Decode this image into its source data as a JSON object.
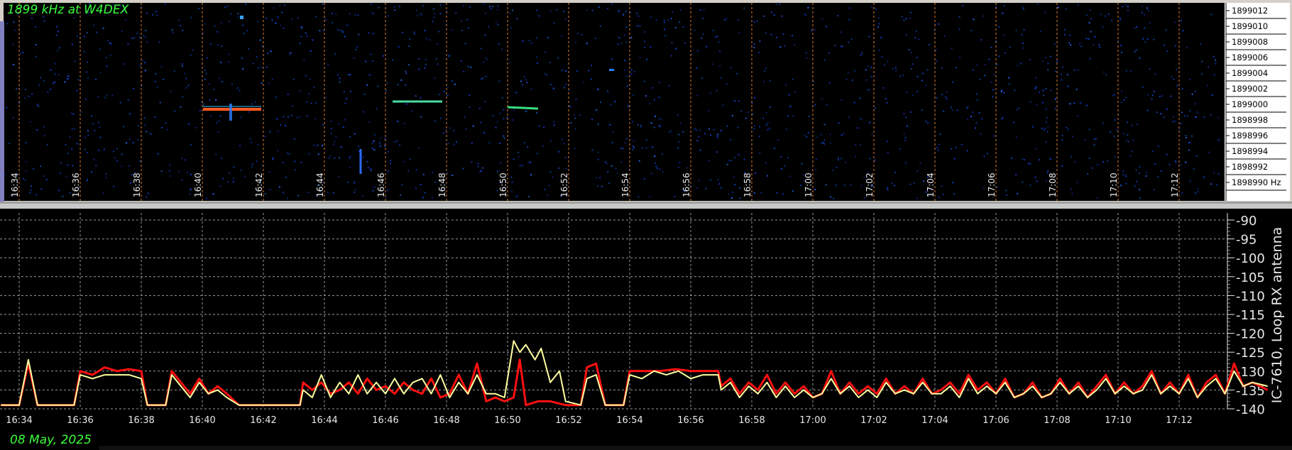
{
  "waterfall": {
    "title": "1899 kHz at W4DEX",
    "freq_labels": [
      "1899012",
      "1899010",
      "1899008",
      "1899006",
      "1899004",
      "1899002",
      "1899000",
      "1898998",
      "1898996",
      "1898994",
      "1898992",
      "1898990 Hz"
    ],
    "time_labels": [
      "16:34",
      "16:36",
      "16:38",
      "16:40",
      "16:42",
      "16:44",
      "16:46",
      "16:48",
      "16:50",
      "16:52",
      "16:54",
      "16:56",
      "16:58",
      "17:00",
      "17:02",
      "17:04",
      "17:06",
      "17:08",
      "17:10",
      "17:12"
    ],
    "colors": {
      "background": "#000000",
      "signal_strong": "#ff5a1e",
      "signal_mid": "#38e080",
      "noise": "#1040c0",
      "grid_line": "#e08030"
    }
  },
  "graph": {
    "date": "08 May, 2025",
    "antenna": "IC-7610, Loop RX antenna",
    "colors": {
      "background": "#000000",
      "grid": "#9a9a9a",
      "series_a": "#ff1010",
      "series_b": "#ffffa0",
      "axis_text": "#e8e8e8"
    }
  },
  "chart_data": {
    "type": "line",
    "ylabel": "IC-7610, Loop RX antenna",
    "ylim": [
      -140,
      -90
    ],
    "yticks": [
      -90,
      -95,
      -100,
      -105,
      -110,
      -115,
      -120,
      -125,
      -130,
      -135,
      -140
    ],
    "x_tick_labels": [
      "16:34",
      "16:36",
      "16:38",
      "16:40",
      "16:42",
      "16:44",
      "16:46",
      "16:48",
      "16:50",
      "16:52",
      "16:54",
      "16:56",
      "16:58",
      "17:00",
      "17:02",
      "17:04",
      "17:06",
      "17:08",
      "17:10",
      "17:12"
    ],
    "x_tick_minutes": [
      0,
      2,
      4,
      6,
      8,
      10,
      12,
      14,
      16,
      18,
      20,
      22,
      24,
      26,
      28,
      30,
      32,
      34,
      36,
      38
    ],
    "xlim_minutes": [
      -0.6,
      40.9
    ],
    "grid": true,
    "series": [
      {
        "color": "#ff1010",
        "points": [
          [
            -0.6,
            -139
          ],
          [
            0,
            -139
          ],
          [
            0.3,
            -128
          ],
          [
            0.6,
            -139
          ],
          [
            1.8,
            -139
          ],
          [
            2.0,
            -130
          ],
          [
            2.4,
            -131
          ],
          [
            2.8,
            -129
          ],
          [
            3.2,
            -130
          ],
          [
            3.6,
            -129.5
          ],
          [
            4.0,
            -130
          ],
          [
            4.2,
            -139
          ],
          [
            4.8,
            -139
          ],
          [
            5.0,
            -130
          ],
          [
            5.3,
            -133
          ],
          [
            5.6,
            -136
          ],
          [
            5.9,
            -132
          ],
          [
            6.2,
            -136
          ],
          [
            6.5,
            -134
          ],
          [
            6.8,
            -136
          ],
          [
            7.2,
            -139
          ],
          [
            8.0,
            -139
          ],
          [
            9.2,
            -139
          ],
          [
            9.3,
            -133
          ],
          [
            9.6,
            -135
          ],
          [
            9.9,
            -133
          ],
          [
            10.2,
            -136
          ],
          [
            10.5,
            -135
          ],
          [
            10.8,
            -133
          ],
          [
            11.1,
            -136
          ],
          [
            11.4,
            -132
          ],
          [
            11.7,
            -135
          ],
          [
            12.0,
            -134
          ],
          [
            12.3,
            -136
          ],
          [
            12.6,
            -133
          ],
          [
            12.9,
            -135
          ],
          [
            13.2,
            -136
          ],
          [
            13.5,
            -132
          ],
          [
            13.8,
            -137
          ],
          [
            14.1,
            -136
          ],
          [
            14.4,
            -131
          ],
          [
            14.7,
            -136
          ],
          [
            15.0,
            -128
          ],
          [
            15.3,
            -138
          ],
          [
            15.6,
            -137
          ],
          [
            15.9,
            -138
          ],
          [
            16.2,
            -137
          ],
          [
            16.4,
            -127
          ],
          [
            16.6,
            -139
          ],
          [
            17.0,
            -138
          ],
          [
            17.4,
            -138
          ],
          [
            17.9,
            -139
          ],
          [
            18.4,
            -139
          ],
          [
            18.6,
            -129
          ],
          [
            18.9,
            -128
          ],
          [
            19.2,
            -139
          ],
          [
            19.8,
            -139
          ],
          [
            20.0,
            -130
          ],
          [
            20.5,
            -130
          ],
          [
            21.0,
            -130
          ],
          [
            21.5,
            -129.5
          ],
          [
            22.0,
            -130
          ],
          [
            22.5,
            -130
          ],
          [
            22.9,
            -130
          ],
          [
            23.0,
            -134
          ],
          [
            23.3,
            -132
          ],
          [
            23.6,
            -136
          ],
          [
            23.9,
            -133
          ],
          [
            24.2,
            -135
          ],
          [
            24.5,
            -131
          ],
          [
            24.8,
            -136
          ],
          [
            25.1,
            -133
          ],
          [
            25.4,
            -136
          ],
          [
            25.7,
            -134
          ],
          [
            26.0,
            -137
          ],
          [
            26.3,
            -136
          ],
          [
            26.6,
            -130
          ],
          [
            26.9,
            -136
          ],
          [
            27.2,
            -133
          ],
          [
            27.5,
            -136
          ],
          [
            27.8,
            -134
          ],
          [
            28.1,
            -136
          ],
          [
            28.4,
            -132
          ],
          [
            28.7,
            -136
          ],
          [
            29.0,
            -134
          ],
          [
            29.3,
            -136
          ],
          [
            29.6,
            -132
          ],
          [
            29.9,
            -136
          ],
          [
            30.2,
            -135
          ],
          [
            30.5,
            -133
          ],
          [
            30.8,
            -136
          ],
          [
            31.1,
            -131
          ],
          [
            31.4,
            -135
          ],
          [
            31.7,
            -133
          ],
          [
            32.0,
            -136
          ],
          [
            32.3,
            -132
          ],
          [
            32.6,
            -137
          ],
          [
            32.9,
            -136
          ],
          [
            33.2,
            -133
          ],
          [
            33.5,
            -137
          ],
          [
            33.8,
            -136
          ],
          [
            34.1,
            -132
          ],
          [
            34.4,
            -136
          ],
          [
            34.7,
            -133
          ],
          [
            35.0,
            -137
          ],
          [
            35.3,
            -134
          ],
          [
            35.6,
            -131
          ],
          [
            35.9,
            -136
          ],
          [
            36.2,
            -133
          ],
          [
            36.5,
            -136
          ],
          [
            36.8,
            -134
          ],
          [
            37.1,
            -130
          ],
          [
            37.4,
            -136
          ],
          [
            37.7,
            -133
          ],
          [
            38.0,
            -136
          ],
          [
            38.3,
            -131
          ],
          [
            38.6,
            -137
          ],
          [
            38.9,
            -133
          ],
          [
            39.2,
            -131
          ],
          [
            39.5,
            -136
          ],
          [
            39.8,
            -128
          ],
          [
            40.1,
            -134
          ],
          [
            40.4,
            -133
          ],
          [
            40.9,
            -135
          ]
        ]
      },
      {
        "color": "#ffffa0",
        "points": [
          [
            -0.6,
            -139
          ],
          [
            0,
            -139
          ],
          [
            0.3,
            -127
          ],
          [
            0.6,
            -139
          ],
          [
            1.8,
            -139
          ],
          [
            2.0,
            -131
          ],
          [
            2.4,
            -132
          ],
          [
            2.8,
            -131
          ],
          [
            3.2,
            -131
          ],
          [
            3.6,
            -131
          ],
          [
            4.0,
            -132
          ],
          [
            4.2,
            -139
          ],
          [
            4.8,
            -139
          ],
          [
            5.0,
            -131
          ],
          [
            5.3,
            -134
          ],
          [
            5.6,
            -137
          ],
          [
            5.9,
            -133
          ],
          [
            6.2,
            -136
          ],
          [
            6.5,
            -135
          ],
          [
            6.8,
            -137
          ],
          [
            7.2,
            -139
          ],
          [
            8.0,
            -139
          ],
          [
            9.2,
            -139
          ],
          [
            9.3,
            -135
          ],
          [
            9.6,
            -137
          ],
          [
            9.9,
            -131
          ],
          [
            10.2,
            -137
          ],
          [
            10.5,
            -133
          ],
          [
            10.8,
            -136
          ],
          [
            11.1,
            -131
          ],
          [
            11.4,
            -136
          ],
          [
            11.7,
            -133
          ],
          [
            12.0,
            -136
          ],
          [
            12.3,
            -132
          ],
          [
            12.6,
            -136
          ],
          [
            12.9,
            -133
          ],
          [
            13.2,
            -132
          ],
          [
            13.5,
            -136
          ],
          [
            13.8,
            -131
          ],
          [
            14.1,
            -137
          ],
          [
            14.4,
            -133
          ],
          [
            14.7,
            -136
          ],
          [
            15.0,
            -131
          ],
          [
            15.3,
            -136
          ],
          [
            15.6,
            -136
          ],
          [
            15.9,
            -137
          ],
          [
            16.2,
            -122
          ],
          [
            16.4,
            -125
          ],
          [
            16.6,
            -123
          ],
          [
            16.9,
            -127
          ],
          [
            17.1,
            -124
          ],
          [
            17.4,
            -133
          ],
          [
            17.7,
            -130
          ],
          [
            17.9,
            -138
          ],
          [
            18.4,
            -139
          ],
          [
            18.6,
            -132
          ],
          [
            18.9,
            -131
          ],
          [
            19.2,
            -139
          ],
          [
            19.8,
            -139
          ],
          [
            20.0,
            -131
          ],
          [
            20.4,
            -132
          ],
          [
            20.8,
            -130
          ],
          [
            21.2,
            -131
          ],
          [
            21.6,
            -130
          ],
          [
            22.0,
            -132
          ],
          [
            22.4,
            -131
          ],
          [
            22.9,
            -131
          ],
          [
            23.0,
            -135
          ],
          [
            23.3,
            -133
          ],
          [
            23.6,
            -137
          ],
          [
            23.9,
            -134
          ],
          [
            24.2,
            -136
          ],
          [
            24.5,
            -133
          ],
          [
            24.8,
            -137
          ],
          [
            25.1,
            -134
          ],
          [
            25.4,
            -137
          ],
          [
            25.7,
            -135
          ],
          [
            26.0,
            -137
          ],
          [
            26.3,
            -136
          ],
          [
            26.6,
            -132
          ],
          [
            26.9,
            -136
          ],
          [
            27.2,
            -134
          ],
          [
            27.5,
            -137
          ],
          [
            27.8,
            -135
          ],
          [
            28.1,
            -137
          ],
          [
            28.4,
            -133
          ],
          [
            28.7,
            -136
          ],
          [
            29.0,
            -135
          ],
          [
            29.3,
            -136
          ],
          [
            29.6,
            -133
          ],
          [
            29.9,
            -136
          ],
          [
            30.2,
            -136
          ],
          [
            30.5,
            -134
          ],
          [
            30.8,
            -137
          ],
          [
            31.1,
            -132
          ],
          [
            31.4,
            -136
          ],
          [
            31.7,
            -134
          ],
          [
            32.0,
            -136
          ],
          [
            32.3,
            -133
          ],
          [
            32.6,
            -137
          ],
          [
            32.9,
            -136
          ],
          [
            33.2,
            -134
          ],
          [
            33.5,
            -137
          ],
          [
            33.8,
            -136
          ],
          [
            34.1,
            -133
          ],
          [
            34.4,
            -136
          ],
          [
            34.7,
            -134
          ],
          [
            35.0,
            -137
          ],
          [
            35.3,
            -135
          ],
          [
            35.6,
            -132
          ],
          [
            35.9,
            -136
          ],
          [
            36.2,
            -134
          ],
          [
            36.5,
            -136
          ],
          [
            36.8,
            -135
          ],
          [
            37.1,
            -131
          ],
          [
            37.4,
            -136
          ],
          [
            37.7,
            -134
          ],
          [
            38.0,
            -136
          ],
          [
            38.3,
            -132
          ],
          [
            38.6,
            -137
          ],
          [
            38.9,
            -134
          ],
          [
            39.2,
            -132
          ],
          [
            39.5,
            -136
          ],
          [
            39.8,
            -130
          ],
          [
            40.1,
            -134
          ],
          [
            40.4,
            -133
          ],
          [
            40.9,
            -134
          ]
        ]
      }
    ]
  }
}
